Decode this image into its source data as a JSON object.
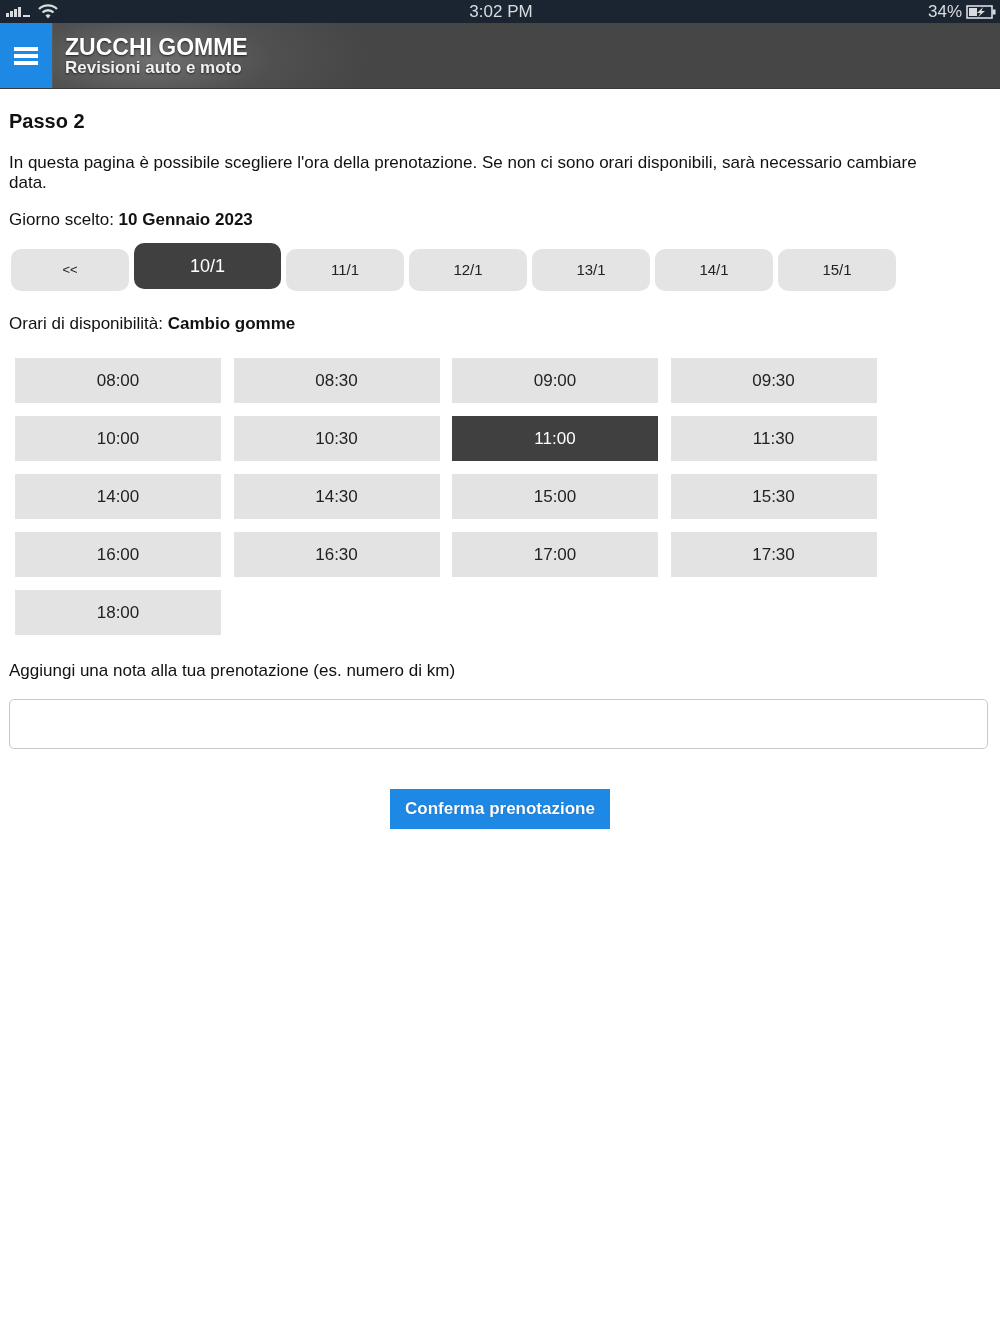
{
  "status_bar": {
    "time": "3:02 PM",
    "battery": "34%"
  },
  "header": {
    "title": "ZUCCHI GOMME",
    "subtitle": "Revisioni auto e moto"
  },
  "step_title": "Passo 2",
  "intro": "In questa pagina è possibile scegliere l'ora della prenotazione. Se non ci sono orari disponibili, sarà necessario cambiare data.",
  "chosen_day": "Giorno scelto: **10 Gennaio 2023**",
  "days": [
    {
      "kind": "nav",
      "label": "<<",
      "selected": false
    },
    {
      "kind": "day",
      "label": "10/1",
      "selected": true
    },
    {
      "kind": "day",
      "label": "11/1",
      "selected": false
    },
    {
      "kind": "day",
      "label": "12/1",
      "selected": false
    },
    {
      "kind": "day",
      "label": "13/1",
      "selected": false
    },
    {
      "kind": "day",
      "label": "14/1",
      "selected": false
    },
    {
      "kind": "day",
      "label": "15/1",
      "selected": false
    }
  ],
  "availability": "Orari di disponibilità: **Cambio gomme**",
  "slots": [
    {
      "time": "08:00",
      "selected": false
    },
    {
      "time": "08:30",
      "selected": false
    },
    {
      "time": "09:00",
      "selected": false
    },
    {
      "time": "09:30",
      "selected": false
    },
    {
      "time": "10:00",
      "selected": false
    },
    {
      "time": "10:30",
      "selected": false
    },
    {
      "time": "11:00",
      "selected": true
    },
    {
      "time": "11:30",
      "selected": false
    },
    {
      "time": "14:00",
      "selected": false
    },
    {
      "time": "14:30",
      "selected": false
    },
    {
      "time": "15:00",
      "selected": false
    },
    {
      "time": "15:30",
      "selected": false
    },
    {
      "time": "16:00",
      "selected": false
    },
    {
      "time": "16:30",
      "selected": false
    },
    {
      "time": "17:00",
      "selected": false
    },
    {
      "time": "17:30",
      "selected": false
    },
    {
      "time": "18:00",
      "selected": false
    }
  ],
  "note": {
    "label": "Aggiungi una nota alla tua prenotazione (es. numero di km)"
  },
  "confirm_button": "Conferma prenotazione"
}
